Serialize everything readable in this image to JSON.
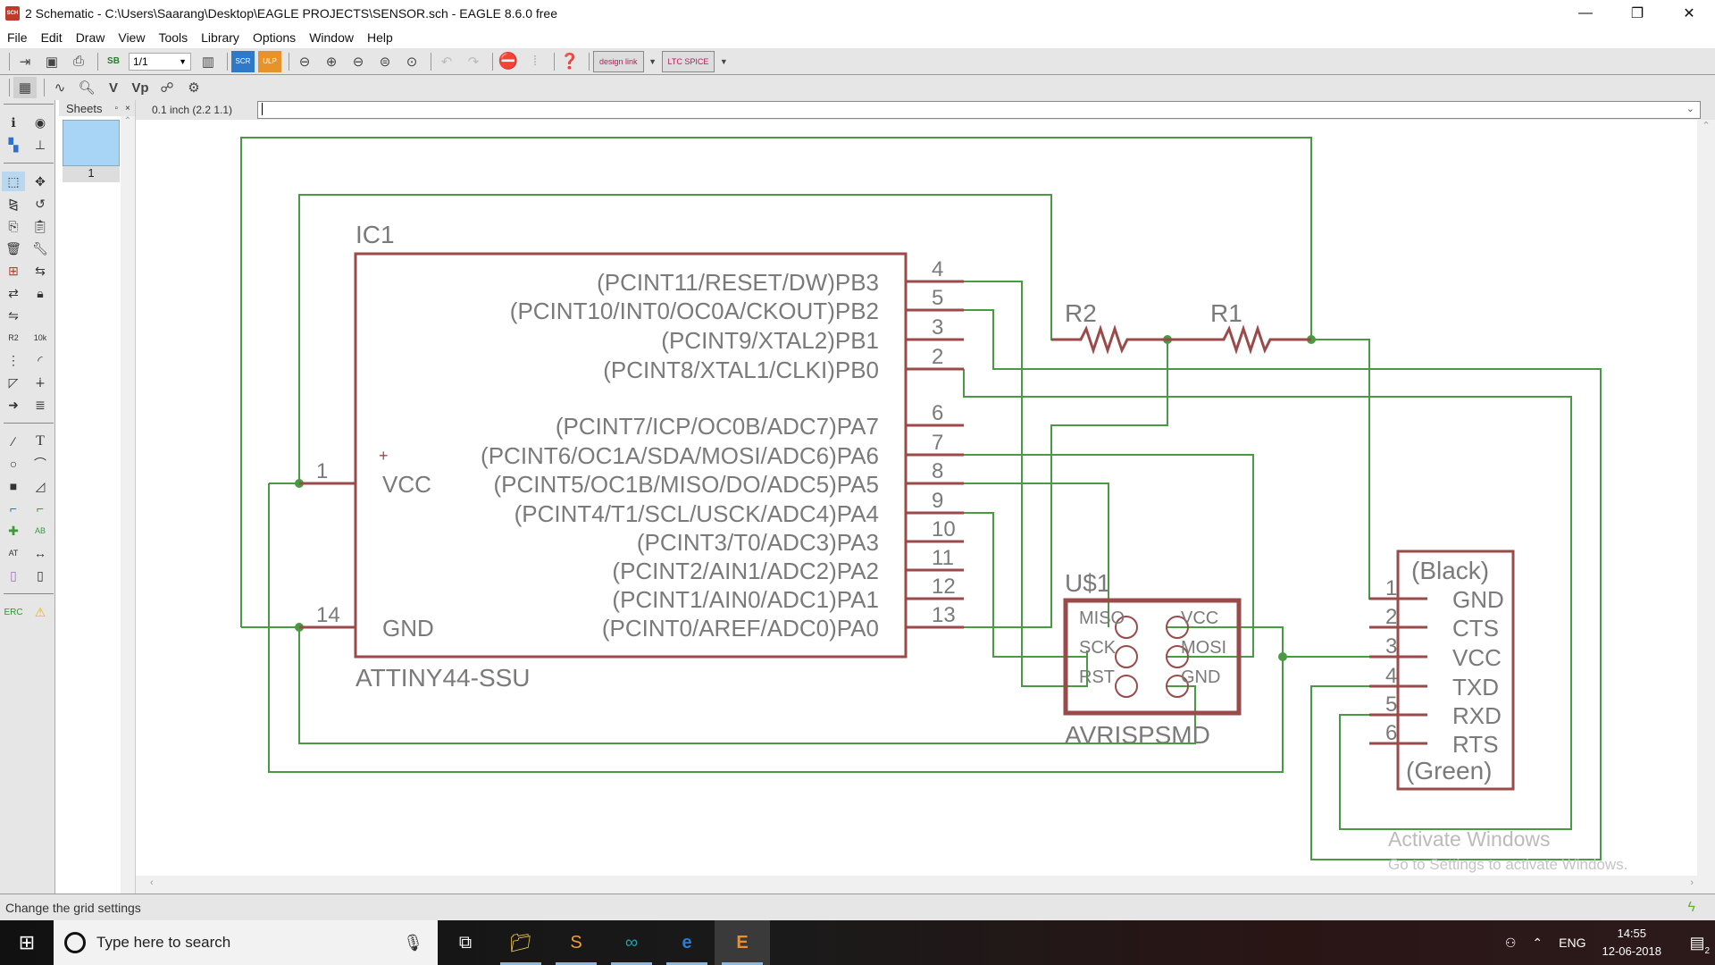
{
  "window": {
    "title": "2 Schematic - C:\\Users\\Saarang\\Desktop\\EAGLE PROJECTS\\SENSOR.sch - EAGLE 8.6.0 free",
    "app_icon_label": "SCH",
    "controls": {
      "minimize": "—",
      "maximize": "❐",
      "close": "✕"
    }
  },
  "menu": [
    "File",
    "Edit",
    "Draw",
    "View",
    "Tools",
    "Library",
    "Options",
    "Window",
    "Help"
  ],
  "toolbar": {
    "sheet_select": "1/1",
    "design_link_label": "design link",
    "ltspice_label": "LTC SPICE"
  },
  "sheets": {
    "title": "Sheets",
    "pin_icon": "▫",
    "close_icon": "×",
    "items": [
      {
        "label": "1"
      }
    ]
  },
  "command": {
    "coord_readout": "0.1 inch (2.2 1.1)",
    "value": ""
  },
  "schematic": {
    "ic1": {
      "name": "IC1",
      "value": "ATTINY44-SSU",
      "left_pins": [
        {
          "num": "1",
          "name": "VCC"
        },
        {
          "num": "14",
          "name": "GND"
        }
      ],
      "right_pins": [
        {
          "num": "4",
          "name": "(PCINT11/RESET/DW)PB3"
        },
        {
          "num": "5",
          "name": "(PCINT10/INT0/OC0A/CKOUT)PB2"
        },
        {
          "num": "3",
          "name": "(PCINT9/XTAL2)PB1"
        },
        {
          "num": "2",
          "name": "(PCINT8/XTAL1/CLKI)PB0"
        },
        {
          "num": "6",
          "name": "(PCINT7/ICP/OC0B/ADC7)PA7"
        },
        {
          "num": "7",
          "name": "(PCINT6/OC1A/SDA/MOSI/ADC6)PA6"
        },
        {
          "num": "8",
          "name": "(PCINT5/OC1B/MISO/DO/ADC5)PA5"
        },
        {
          "num": "9",
          "name": "(PCINT4/T1/SCL/USCK/ADC4)PA4"
        },
        {
          "num": "10",
          "name": "(PCINT3/T0/ADC3)PA3"
        },
        {
          "num": "11",
          "name": "(PCINT2/AIN1/ADC2)PA2"
        },
        {
          "num": "12",
          "name": "(PCINT1/AIN0/ADC1)PA1"
        },
        {
          "num": "13",
          "name": "(PCINT0/AREF/ADC0)PA0"
        }
      ]
    },
    "r2": {
      "name": "R2"
    },
    "r1": {
      "name": "R1"
    },
    "us1": {
      "name": "U$1",
      "value": "AVRISPSMD",
      "pins": [
        "MISO",
        "VCC",
        "SCK",
        "MOSI",
        "RST",
        "GND"
      ]
    },
    "ftdi": {
      "top_label": "(Black)",
      "bottom_label": "(Green)",
      "pins": [
        {
          "num": "1",
          "name": "GND"
        },
        {
          "num": "2",
          "name": "CTS"
        },
        {
          "num": "3",
          "name": "VCC"
        },
        {
          "num": "4",
          "name": "TXD"
        },
        {
          "num": "5",
          "name": "RXD"
        },
        {
          "num": "6",
          "name": "RTS"
        }
      ]
    },
    "colors": {
      "wire": "#4a9a44",
      "symbol": "#9b4a4a",
      "junction": "#4a9a44",
      "text": "#7a7a7a"
    }
  },
  "watermark": {
    "line1": "Activate Windows",
    "line2": "Go to Settings to activate Windows."
  },
  "status": {
    "message": "Change the grid settings"
  },
  "taskbar": {
    "search_placeholder": "Type here to search",
    "apps": [
      "task-view",
      "file-explorer",
      "sublime-text",
      "arduino",
      "edge",
      "eagle"
    ],
    "language": "ENG",
    "time": "14:55",
    "date": "12-06-2018",
    "notification_count": "2"
  }
}
